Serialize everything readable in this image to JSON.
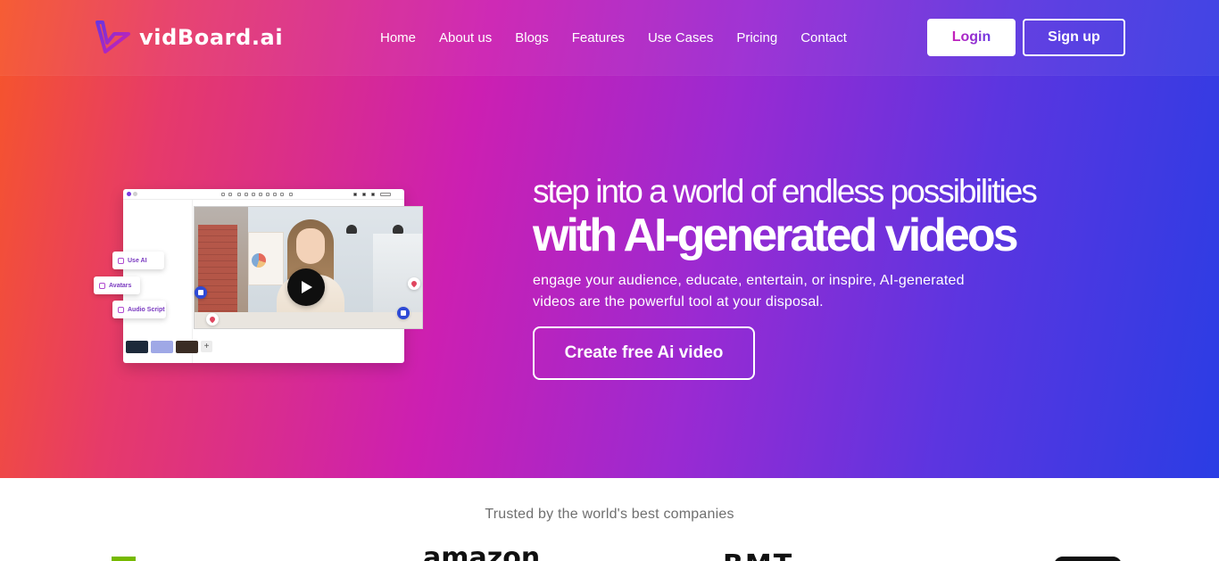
{
  "brand": {
    "name": "vidBoard.ai",
    "gradient_start": "#6a35e0",
    "gradient_end": "#c81fb6"
  },
  "nav": {
    "links": [
      "Home",
      "About us",
      "Blogs",
      "Features",
      "Use Cases",
      "Pricing",
      "Contact"
    ],
    "login_label": "Login",
    "signup_label": "Sign up"
  },
  "hero": {
    "headline_line1": "step into a world of endless possibilities",
    "headline_line2": "with AI-generated videos",
    "subtext": "engage your audience, educate, entertain, or inspire, AI-generated videos are the powerful tool at your disposal.",
    "cta_label": "Create free Ai video",
    "background_colors": [
      "#f6552a",
      "#cc1fb2",
      "#9a2ad2",
      "#2a3de4"
    ]
  },
  "mockup": {
    "chips": [
      "Use AI",
      "Avatars",
      "Audio Script"
    ],
    "add_symbol": "+"
  },
  "trusted": {
    "caption": "Trusted by the world's best companies",
    "logos": [
      "nvidia-logo",
      "amazon",
      "BMT",
      "pill-logo"
    ],
    "amazon_text": "amazon",
    "bmt_text": "BMT"
  }
}
